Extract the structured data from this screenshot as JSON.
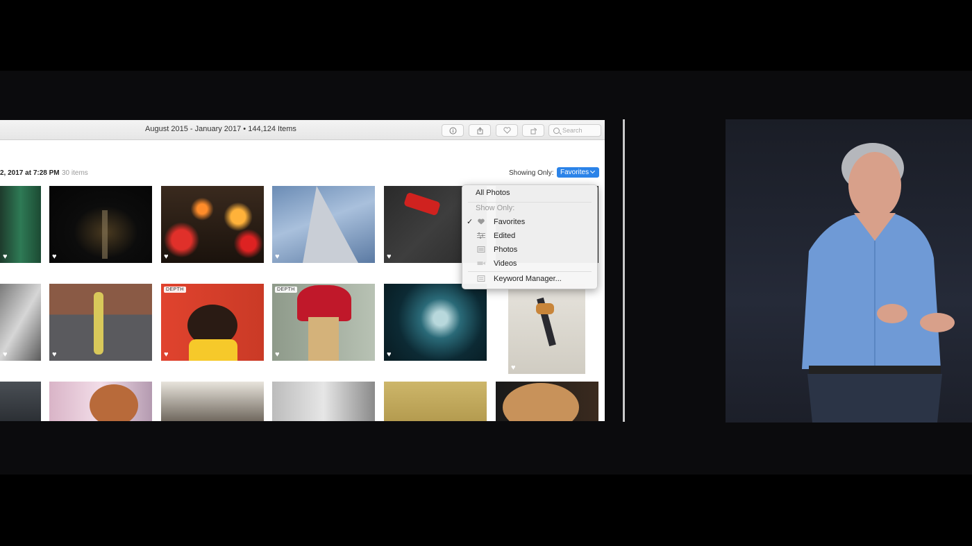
{
  "window": {
    "title": "August 2015 - January 2017 • 144,124 Items"
  },
  "toolbar": {
    "buttons": [
      {
        "name": "info-icon"
      },
      {
        "name": "share-icon"
      },
      {
        "name": "heart-icon"
      },
      {
        "name": "rotate-icon"
      }
    ],
    "search_placeholder": "Search"
  },
  "moment": {
    "date": "2, 2017 at 7:28 PM",
    "count": "30 items"
  },
  "filter": {
    "label": "Showing Only:",
    "selected": "Favorites"
  },
  "menu": {
    "all_photos": "All Photos",
    "section_label": "Show Only:",
    "items": [
      {
        "label": "Favorites",
        "icon": "heart-icon",
        "checked": true
      },
      {
        "label": "Edited",
        "icon": "sliders-icon"
      },
      {
        "label": "Photos",
        "icon": "photo-icon"
      },
      {
        "label": "Videos",
        "icon": "video-icon"
      },
      {
        "label": "Keyword Manager...",
        "icon": "keyword-icon"
      }
    ]
  },
  "badges": {
    "depth": "DEPTH"
  },
  "colors": {
    "accent": "#2b83e8",
    "heart": "#ffffff"
  }
}
